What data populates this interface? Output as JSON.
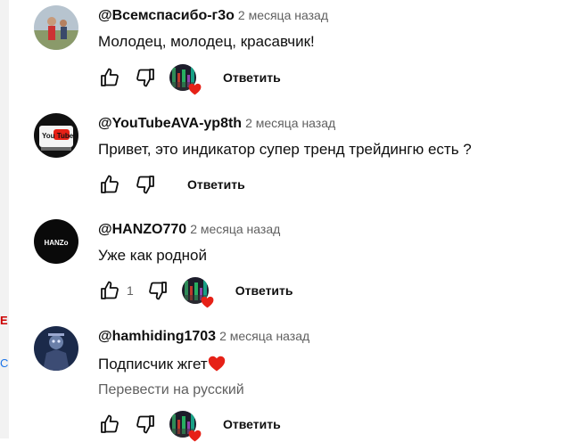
{
  "comments": [
    {
      "author": "@Всемспасибо-г3о",
      "time": "2 месяца назад",
      "text": "Молодец, молодец, красавчик!",
      "likes": "",
      "creator_heart": true,
      "reply_label": "Ответить"
    },
    {
      "author": "@YouTubeAVA-yp8th",
      "time": "2 месяца назад",
      "text": "Привет, это индикатор супер тренд трейдингю есть ?",
      "avatar_text": "You Tube",
      "likes": "",
      "creator_heart": false,
      "reply_label": "Ответить"
    },
    {
      "author": "@HANZO770",
      "time": "2 месяца назад",
      "text": "Уже как родной",
      "avatar_text": "HANZo",
      "likes": "1",
      "creator_heart": true,
      "reply_label": "Ответить"
    },
    {
      "author": "@hamhiding1703",
      "time": "2 месяца назад",
      "text": "Подписчик жгет",
      "translate_label": "Перевести на русский",
      "likes": "",
      "creator_heart": true,
      "reply_label": "Ответить"
    }
  ],
  "edge": {
    "left_glyph_1": "E",
    "left_glyph_2": "C"
  },
  "colors": {
    "heart": "#e62117",
    "meta_text": "#606060",
    "text": "#0f0f0f"
  },
  "icons": [
    "thumbs-up-icon",
    "thumbs-down-icon",
    "heart-icon"
  ]
}
